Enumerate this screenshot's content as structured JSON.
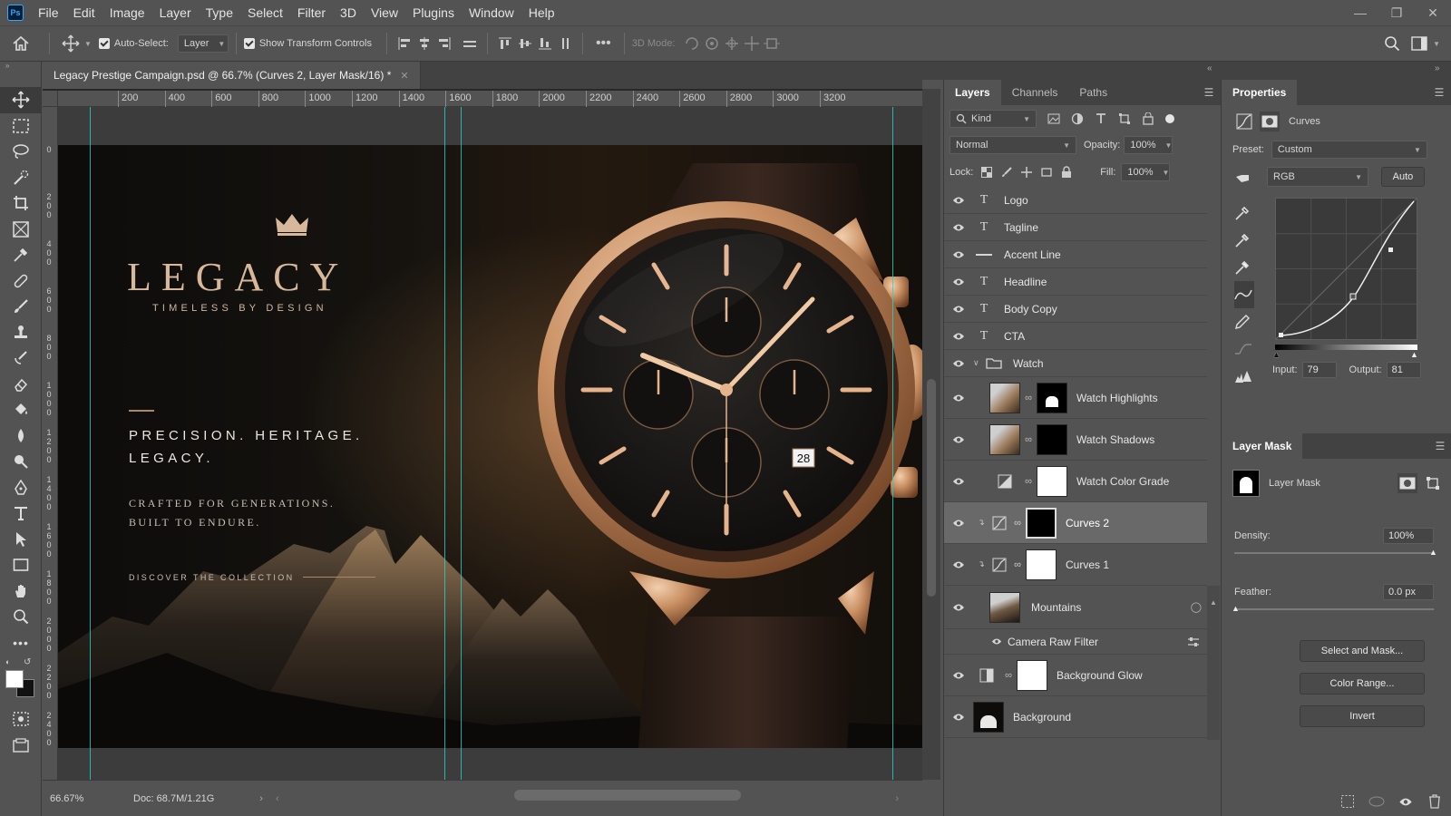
{
  "app": {
    "logo": "Ps"
  },
  "menu": [
    "File",
    "Edit",
    "Image",
    "Layer",
    "Type",
    "Select",
    "Filter",
    "3D",
    "View",
    "Plugins",
    "Window",
    "Help"
  ],
  "options": {
    "auto_select_label": "Auto-Select:",
    "auto_select_value": "Layer",
    "show_transform_label": "Show Transform Controls",
    "threed_mode_label": "3D Mode:"
  },
  "document": {
    "tab_title": "Legacy Prestige Campaign.psd @ 66.7% (Curves 2, Layer Mask/16) *",
    "zoom": "66.67%",
    "doc_size": "Doc: 68.7M/1.21G"
  },
  "rulers": {
    "h": [
      "200",
      "400",
      "600",
      "800",
      "1000",
      "1200",
      "1400",
      "1600",
      "1800",
      "2000",
      "2200",
      "2400",
      "2600",
      "2800",
      "3000",
      "3200"
    ],
    "v": [
      "0",
      "2 0 0",
      "4 0 0",
      "6 0 0",
      "8 0 0",
      "1 0 0 0",
      "1 2 0 0",
      "1 4 0 0",
      "1 6 0 0",
      "1 8 0 0",
      "2 0 0 0",
      "2 2 0 0",
      "2 4 0 0"
    ]
  },
  "artwork": {
    "brand": "LEGACY",
    "tagline": "TIMELESS BY DESIGN",
    "headline_1": "PRECISION. HERITAGE.",
    "headline_2": "LEGACY.",
    "body_1": "CRAFTED FOR GENERATIONS.",
    "body_2": "BUILT TO ENDURE.",
    "cta": "DISCOVER THE COLLECTION",
    "dial_date": "28"
  },
  "layers_panel": {
    "tabs": [
      "Layers",
      "Channels",
      "Paths"
    ],
    "filter_kind": "Kind",
    "blend_mode": "Normal",
    "opacity_label": "Opacity:",
    "opacity_value": "100%",
    "lock_label": "Lock:",
    "fill_label": "Fill:",
    "fill_value": "100%",
    "layers": [
      {
        "name": "Logo",
        "kind": "text"
      },
      {
        "name": "Tagline",
        "kind": "text"
      },
      {
        "name": "Accent Line",
        "kind": "shape"
      },
      {
        "name": "Headline",
        "kind": "text"
      },
      {
        "name": "Body Copy",
        "kind": "text"
      },
      {
        "name": "CTA",
        "kind": "text"
      },
      {
        "name": "Watch",
        "kind": "group"
      },
      {
        "name": "Watch Highlights",
        "kind": "pixel"
      },
      {
        "name": "Watch Shadows",
        "kind": "pixel"
      },
      {
        "name": "Watch Color Grade",
        "kind": "adjustment"
      },
      {
        "name": "Curves 2",
        "kind": "curves"
      },
      {
        "name": "Curves 1",
        "kind": "curves"
      },
      {
        "name": "Mountains",
        "kind": "smart"
      },
      {
        "name": "Camera Raw Filter",
        "kind": "filter"
      },
      {
        "name": "Background Glow",
        "kind": "adjustment"
      },
      {
        "name": "Background",
        "kind": "pixel"
      }
    ]
  },
  "properties_panel": {
    "title": "Properties",
    "adjustment": "Curves",
    "preset_label": "Preset:",
    "preset_value": "Custom",
    "channel": "RGB",
    "auto_label": "Auto",
    "input_label": "Input:",
    "input_value": "79",
    "output_label": "Output:",
    "output_value": "81",
    "mask_section_title": "Layer Mask",
    "mask_label": "Layer Mask",
    "density_label": "Density:",
    "density_value": "100%",
    "density_level": 1.0,
    "feather_label": "Feather:",
    "feather_value": "0.0 px",
    "feather_level": 0.0,
    "select_mask_label": "Select and Mask...",
    "color_range_label": "Color Range...",
    "invert_label": "Invert"
  },
  "colors": {
    "accent_guide": "#2ad1cc",
    "gold": "#d7b89b",
    "ps_blue": "#31a8ff"
  }
}
